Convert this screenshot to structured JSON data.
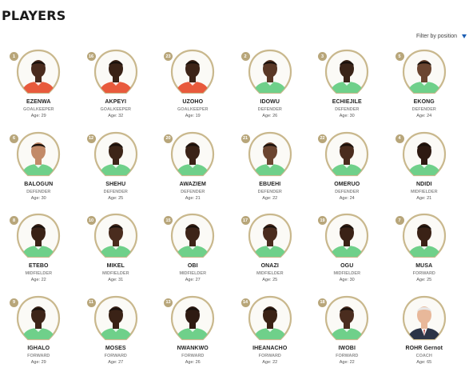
{
  "header": {
    "title": "PLAYERS",
    "filter_label": "Filter by position"
  },
  "colors": {
    "frame_gold": "#c9b88d",
    "number_badge": "#b8a67a",
    "filter_icon": "#1d5fb4"
  },
  "players": [
    {
      "number": "1",
      "name": "EZENWA",
      "position": "GOALKEEPER",
      "age": "Age: 29",
      "shirt": "#e85a3c",
      "skin": "#4a2b1e"
    },
    {
      "number": "16",
      "name": "AKPEYI",
      "position": "GOALKEEPER",
      "age": "Age: 32",
      "shirt": "#e85a3c",
      "skin": "#3a2216"
    },
    {
      "number": "23",
      "name": "UZOHO",
      "position": "GOALKEEPER",
      "age": "Age: 19",
      "shirt": "#e85a3c",
      "skin": "#3d2418"
    },
    {
      "number": "2",
      "name": "IDOWU",
      "position": "DEFENDER",
      "age": "Age: 26",
      "shirt": "#6fd08a",
      "skin": "#5a3826"
    },
    {
      "number": "3",
      "name": "ECHIEJILE",
      "position": "DEFENDER",
      "age": "Age: 30",
      "shirt": "#6fd08a",
      "skin": "#3a2418"
    },
    {
      "number": "5",
      "name": "EKONG",
      "position": "DEFENDER",
      "age": "Age: 24",
      "shirt": "#6fd08a",
      "skin": "#6b4530"
    },
    {
      "number": "6",
      "name": "BALOGUN",
      "position": "DEFENDER",
      "age": "Age: 30",
      "shirt": "#6fd08a",
      "skin": "#c28a68"
    },
    {
      "number": "12",
      "name": "SHEHU",
      "position": "DEFENDER",
      "age": "Age: 25",
      "shirt": "#6fd08a",
      "skin": "#3d2518"
    },
    {
      "number": "20",
      "name": "AWAZIEM",
      "position": "DEFENDER",
      "age": "Age: 21",
      "shirt": "#6fd08a",
      "skin": "#3a2216"
    },
    {
      "number": "21",
      "name": "EBUEHI",
      "position": "DEFENDER",
      "age": "Age: 22",
      "shirt": "#6fd08a",
      "skin": "#6b4530"
    },
    {
      "number": "22",
      "name": "OMERUO",
      "position": "DEFENDER",
      "age": "Age: 24",
      "shirt": "#6fd08a",
      "skin": "#4a2c1e"
    },
    {
      "number": "4",
      "name": "NDIDI",
      "position": "MIDFIELDER",
      "age": "Age: 21",
      "shirt": "#6fd08a",
      "skin": "#2e1a12"
    },
    {
      "number": "8",
      "name": "ETEBO",
      "position": "MIDFIELDER",
      "age": "Age: 22",
      "shirt": "#6fd08a",
      "skin": "#3a2216"
    },
    {
      "number": "10",
      "name": "MIKEL",
      "position": "MIDFIELDER",
      "age": "Age: 31",
      "shirt": "#6fd08a",
      "skin": "#4a2c1e"
    },
    {
      "number": "15",
      "name": "OBI",
      "position": "MIDFIELDER",
      "age": "Age: 27",
      "shirt": "#6fd08a",
      "skin": "#3d2418"
    },
    {
      "number": "17",
      "name": "ONAZI",
      "position": "MIDFIELDER",
      "age": "Age: 25",
      "shirt": "#6fd08a",
      "skin": "#4a2c1e"
    },
    {
      "number": "19",
      "name": "OGU",
      "position": "MIDFIELDER",
      "age": "Age: 30",
      "shirt": "#6fd08a",
      "skin": "#3a2216"
    },
    {
      "number": "7",
      "name": "MUSA",
      "position": "FORWARD",
      "age": "Age: 25",
      "shirt": "#6fd08a",
      "skin": "#3a2216"
    },
    {
      "number": "9",
      "name": "IGHALO",
      "position": "FORWARD",
      "age": "Age: 29",
      "shirt": "#6fd08a",
      "skin": "#3d2418"
    },
    {
      "number": "11",
      "name": "MOSES",
      "position": "FORWARD",
      "age": "Age: 27",
      "shirt": "#6fd08a",
      "skin": "#3a2216"
    },
    {
      "number": "13",
      "name": "NWANKWO",
      "position": "FORWARD",
      "age": "Age: 26",
      "shirt": "#6fd08a",
      "skin": "#2e1a12"
    },
    {
      "number": "14",
      "name": "IHEANACHO",
      "position": "FORWARD",
      "age": "Age: 22",
      "shirt": "#6fd08a",
      "skin": "#3a2216"
    },
    {
      "number": "18",
      "name": "IWOBI",
      "position": "FORWARD",
      "age": "Age: 22",
      "shirt": "#6fd08a",
      "skin": "#4a2c1e"
    },
    {
      "number": "",
      "name": "ROHR Gernot",
      "position": "COACH",
      "age": "Age: 65",
      "shirt": "#2c3447",
      "skin": "#e8b89a"
    }
  ]
}
